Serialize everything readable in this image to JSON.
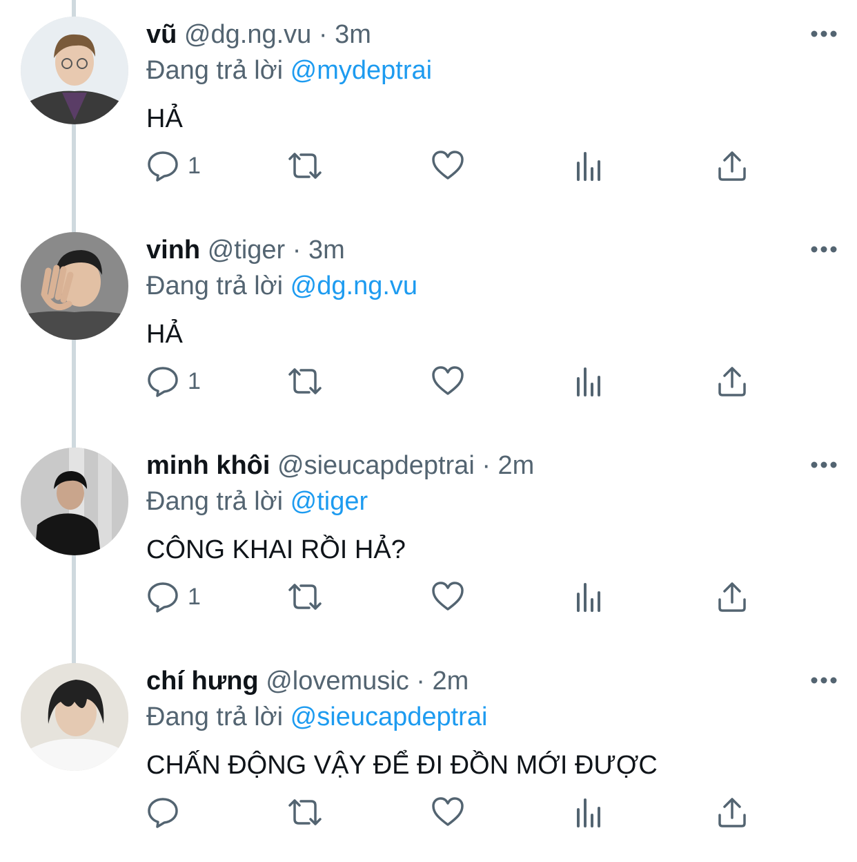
{
  "tweets": [
    {
      "display_name": "vũ",
      "handle": "@dg.ng.vu",
      "separator": "·",
      "time": "3m",
      "reply_prefix": "Đang trả lời",
      "reply_to": "@mydeptrai",
      "text": "HẢ",
      "reply_count": "1"
    },
    {
      "display_name": "vinh",
      "handle": "@tiger",
      "separator": "·",
      "time": "3m",
      "reply_prefix": "Đang trả lời",
      "reply_to": "@dg.ng.vu",
      "text": "HẢ",
      "reply_count": "1"
    },
    {
      "display_name": "minh khôi",
      "handle": "@sieucapdeptrai",
      "separator": "·",
      "time": "2m",
      "reply_prefix": "Đang trả lời",
      "reply_to": "@tiger",
      "text": "CÔNG KHAI RỒI HẢ?",
      "reply_count": "1"
    },
    {
      "display_name": "chí hưng",
      "handle": "@lovemusic",
      "separator": "·",
      "time": "2m",
      "reply_prefix": "Đang trả lời",
      "reply_to": "@sieucapdeptrai",
      "text": "CHẤN ĐỘNG VẬY ĐỂ ĐI ĐỒN MỚI ĐƯỢC",
      "reply_count": ""
    }
  ],
  "icons": {
    "reply": "reply-icon",
    "retweet": "retweet-icon",
    "like": "heart-icon",
    "views": "views-chart-icon",
    "share": "share-icon",
    "more": "more-options-icon"
  },
  "colors": {
    "text": "#0f1419",
    "secondary": "#536471",
    "mention": "#1d9bf0",
    "thread_line": "#cfd9de"
  }
}
